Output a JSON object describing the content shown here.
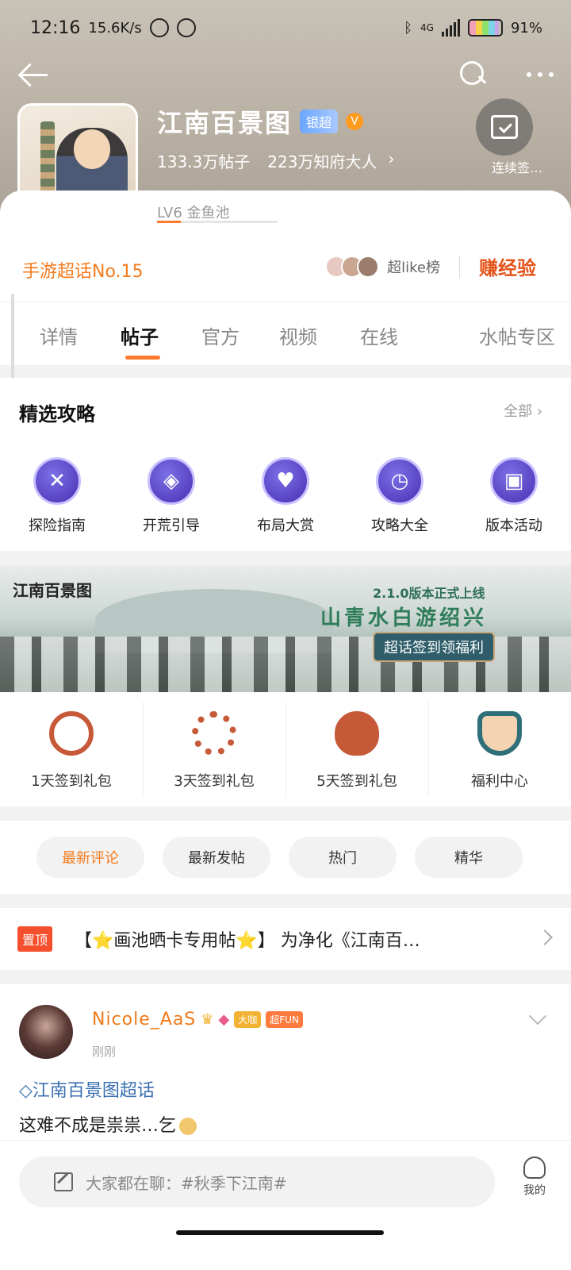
{
  "status_bar": {
    "time": "12:16",
    "speed": "15.6K/s",
    "battery": "91%",
    "network": "4G"
  },
  "header": {
    "forum_name": "江南百景图",
    "badge_silver": "银超",
    "badge_v": "V",
    "posts": "133.3万帖子",
    "members": "223万知府大人",
    "checkin_label": "连续签…",
    "level": "LV6 金鱼池",
    "level_progress": 0.2
  },
  "rank": {
    "label": "手游超话No.15",
    "like_label": "超like榜",
    "earn_label": "赚经验"
  },
  "tabs": [
    "详情",
    "帖子",
    "官方",
    "视频",
    "在线",
    "水帖专区"
  ],
  "active_tab": "帖子",
  "guides": {
    "title": "精选攻略",
    "all_label": "全部",
    "items": [
      "探险指南",
      "开荒引导",
      "布局大赏",
      "攻略大全",
      "版本活动"
    ]
  },
  "banner": {
    "logo": "江南百景图",
    "version": "2.1.0版本正式上线",
    "slogan": "山青水白游绍兴",
    "tag": "超话签到领福利"
  },
  "gifts": [
    "1天签到礼包",
    "3天签到礼包",
    "5天签到礼包",
    "福利中心"
  ],
  "filters": [
    "最新评论",
    "最新发帖",
    "热门",
    "精华"
  ],
  "active_filter": "最新评论",
  "pinned": {
    "tag": "置顶",
    "text": "【⭐画池晒卡专用帖⭐】 为净化《江南百…"
  },
  "post": {
    "username": "Nicole_AaS",
    "badges": [
      "大咖",
      "超FUN"
    ],
    "time": "刚刚",
    "topic": "江南百景图超话",
    "body": "这难不成是祟祟…乞"
  },
  "bottom": {
    "placeholder": "大家都在聊：#秋季下江南#",
    "me_label": "我的"
  }
}
